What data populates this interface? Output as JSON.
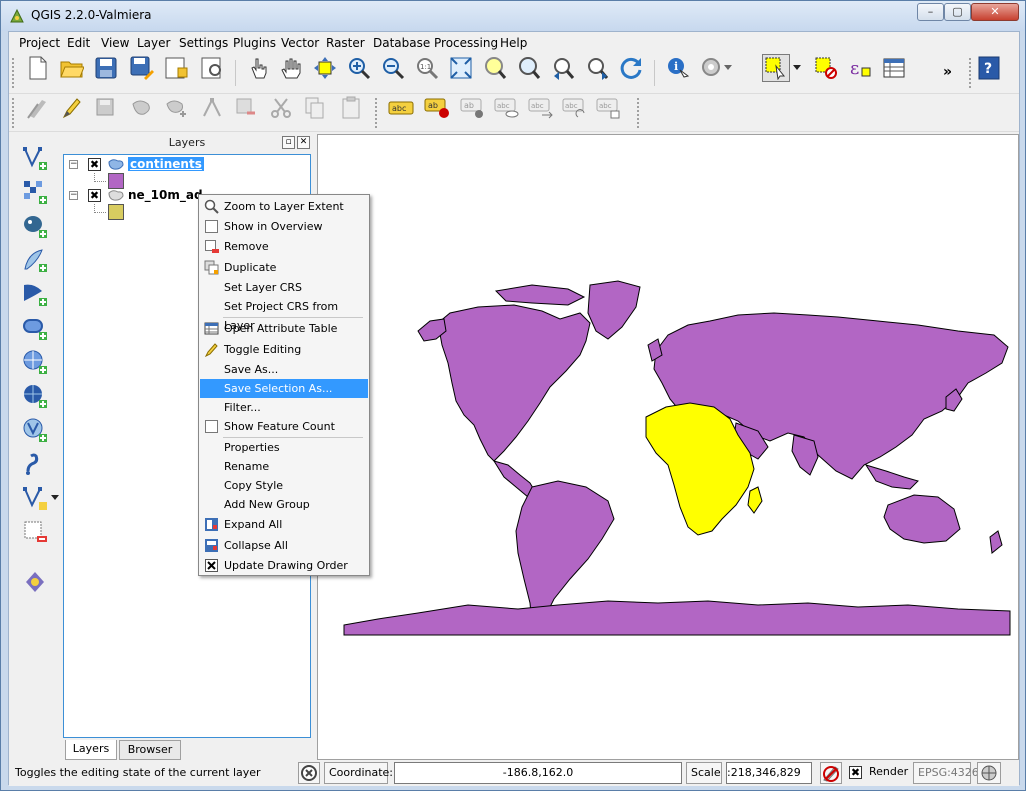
{
  "window": {
    "title": "QGIS 2.2.0-Valmiera",
    "min": "–",
    "max": "▢",
    "close": "✕"
  },
  "menubar": [
    "Project",
    "Edit",
    "View",
    "Layer",
    "Settings",
    "Plugins",
    "Vector",
    "Raster",
    "Database",
    "Processing",
    "Help"
  ],
  "toolbar": {
    "more": "»"
  },
  "layers_panel": {
    "title": "Layers",
    "float_btn": "▫",
    "close_btn": "✕",
    "layers": [
      {
        "name": "continents",
        "visible": "✖",
        "expander": "−",
        "color": "#b266c4"
      },
      {
        "name": "ne_10m_ad",
        "visible": "✖",
        "expander": "−",
        "color": "#d8cc60"
      }
    ],
    "tabs": [
      "Layers",
      "Browser"
    ]
  },
  "context_menu": {
    "items": [
      {
        "label": "Zoom to Layer Extent",
        "icon": "zoom-extent-icon"
      },
      {
        "label": "Show in Overview",
        "icon": "checkbox-icon"
      },
      {
        "label": "Remove",
        "icon": "remove-layer-icon"
      },
      {
        "label": "Duplicate",
        "icon": "duplicate-layer-icon"
      },
      {
        "label": "Set Layer CRS",
        "icon": ""
      },
      {
        "label": "Set Project CRS from Layer",
        "icon": ""
      },
      {
        "label": "Open Attribute Table",
        "icon": "attribute-table-icon"
      },
      {
        "label": "Toggle Editing",
        "icon": "pencil-icon"
      },
      {
        "label": "Save As...",
        "icon": ""
      },
      {
        "label": "Save Selection As...",
        "icon": ""
      },
      {
        "label": "Filter...",
        "icon": ""
      },
      {
        "label": "Show Feature Count",
        "icon": "checkbox-icon"
      },
      {
        "label": "Properties",
        "icon": ""
      },
      {
        "label": "Rename",
        "icon": ""
      },
      {
        "label": "Copy Style",
        "icon": ""
      },
      {
        "label": "Add New Group",
        "icon": ""
      },
      {
        "label": "Expand All",
        "icon": "expand-all-icon"
      },
      {
        "label": "Collapse All",
        "icon": "collapse-all-icon"
      },
      {
        "label": "Update Drawing Order",
        "icon": "checked-box-icon"
      }
    ]
  },
  "statusbar": {
    "message": "Toggles the editing state of the current layer",
    "coordinate_label": "Coordinate:",
    "coordinate_value": "-186.8,162.0",
    "scale_label": "Scale",
    "scale_value": ":218,346,829",
    "render_label": "Render",
    "render_check": "✖",
    "crs": "EPSG:4326"
  },
  "colors": {
    "continents": "#b266c4",
    "africa": "#ffff00",
    "selection": "#3399ff"
  }
}
